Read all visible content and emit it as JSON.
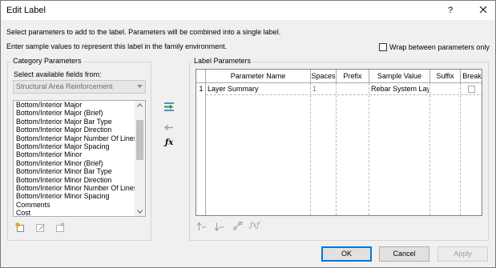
{
  "window": {
    "title": "Edit Label",
    "help": "?"
  },
  "instructions": {
    "line1": "Select parameters to add to the label.  Parameters will be combined into a single label.",
    "line2": "Enter sample values to represent this label in the family environment."
  },
  "wrap_checkbox": {
    "label": "Wrap between parameters only",
    "checked": false
  },
  "category": {
    "group_label": "Category Parameters",
    "select_label": "Select available fields from:",
    "combo_value": "Structural Area Reinforcement",
    "items": [
      "Bottom/Interior Major",
      "Bottom/Interior Major (Brief)",
      "Bottom/Interior Major Bar Type",
      "Bottom/Interior Major Direction",
      "Bottom/Interior Major Number Of Lines",
      "Bottom/Interior Major Spacing",
      "Bottom/Interior Minor",
      "Bottom/Interior Minor (Brief)",
      "Bottom/Interior Minor Bar Type",
      "Bottom/Interior Minor Direction",
      "Bottom/Interior Minor Number Of Lines",
      "Bottom/Interior Minor Spacing",
      "Comments",
      "Cost"
    ]
  },
  "label_params": {
    "group_label": "Label Parameters",
    "columns": [
      "Parameter Name",
      "Spaces",
      "Prefix",
      "Sample Value",
      "Suffix",
      "Break"
    ],
    "rows": [
      {
        "num": "1",
        "name": "Layer Summary",
        "spaces": "1",
        "prefix": "",
        "sample": "Rebar System Lay",
        "suffix": "",
        "break": false
      }
    ]
  },
  "icons": {
    "add": "add-parameter-icon",
    "remove": "remove-parameter-icon",
    "formula": "fx-icon",
    "new_param": "new-parameter-icon",
    "edit_param": "edit-parameter-icon",
    "delete_param": "delete-parameter-icon",
    "move_up": "move-up-icon",
    "move_down": "move-down-icon",
    "edit_format": "edit-format-icon",
    "fx_small": "fx-small-icon"
  },
  "buttons": {
    "ok": "OK",
    "cancel": "Cancel",
    "apply": "Apply"
  }
}
